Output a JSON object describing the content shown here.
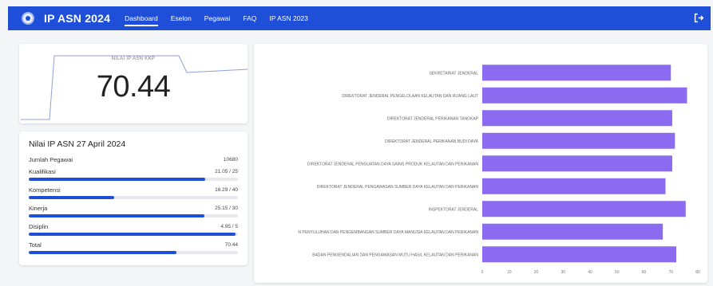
{
  "header": {
    "brand": "IP ASN 2024",
    "nav": [
      {
        "label": "Dashboard",
        "active": true
      },
      {
        "label": "Eselon",
        "active": false
      },
      {
        "label": "Pegawai",
        "active": false
      },
      {
        "label": "FAQ",
        "active": false
      },
      {
        "label": "IP ASN 2023",
        "active": false
      }
    ],
    "logo_icon": "emblem-icon",
    "logout_icon": "logout-icon"
  },
  "kkp": {
    "label": "NILAI IP ASN KKP",
    "value": "70.44"
  },
  "nilai": {
    "title": "Nilai IP ASN 27 April 2024",
    "jumlah_label": "Jumlah Pegawai",
    "jumlah_value": "10680",
    "items": [
      {
        "label": "Kualifikasi",
        "value": "21.05 / 25",
        "fraction": 0.842
      },
      {
        "label": "Kompetensi",
        "value": "16.29 / 40",
        "fraction": 0.407
      },
      {
        "label": "Kinerja",
        "value": "25.15 / 30",
        "fraction": 0.838
      },
      {
        "label": "Disiplin",
        "value": "4.95 / 5",
        "fraction": 0.99
      },
      {
        "label": "Total",
        "value": "70.44",
        "fraction": 0.7044
      }
    ]
  },
  "colors": {
    "primary": "#1f4fd8",
    "bar": "#8b6cf0"
  },
  "chart_data": {
    "type": "bar",
    "orientation": "horizontal",
    "categories": [
      "SEKRETARIAT JENDERAL",
      "DIREKTORAT JENDERAL PENGELOLAAN KELAUTAN DAN RUANG LAUT",
      "DIREKTORAT JENDERAL PERIKANAN TANGKAP",
      "DIREKTORAT JENDERAL PERIKANAN BUDI DAYA",
      "DIREKTORAT JENDERAL PENGUATAN DAYA SAING PRODUK KELAUTAN DAN PERIKANAN",
      "DIREKTORAT JENDERAL PENGAWASAN SUMBER DAYA KELAUTAN DAN PERIKANAN",
      "INSPEKTORAT JENDERAL",
      "N PENYULUHAN DAN PENGEMBANGAN SUMBER DAYA MANUSIA KELAUTAN DAN PERIKANAN",
      "BADAN PENGENDALIAN DAN PENGAWASAN MUTU HASIL KELAUTAN DAN PERIKANAN"
    ],
    "values": [
      70,
      76,
      70.5,
      71.5,
      70.5,
      68,
      75.5,
      67,
      72
    ],
    "xlim": [
      0,
      80
    ],
    "xticks": [
      "0",
      "10",
      "20",
      "30",
      "40",
      "50",
      "60",
      "70",
      "80"
    ],
    "grid": false
  }
}
